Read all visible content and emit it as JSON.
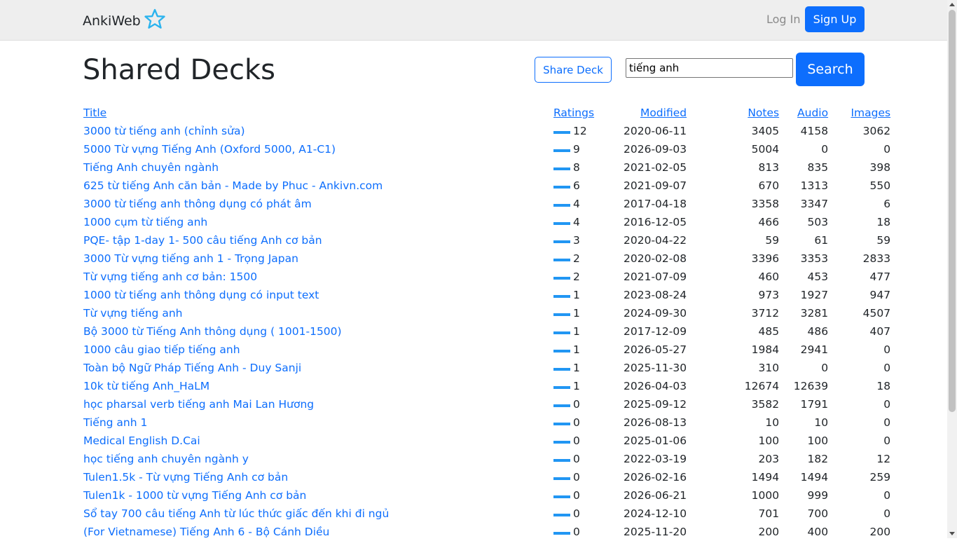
{
  "nav": {
    "brand": "AnkiWeb",
    "login": "Log In",
    "signup": "Sign Up"
  },
  "header": {
    "title": "Shared Decks",
    "share_label": "Share Deck",
    "search_value": "tiếng anh",
    "search_label": "Search"
  },
  "colors": {
    "accent": "#0d6efd",
    "rating_bar": "#2196f3",
    "navbar_bg": "#eeeeee"
  },
  "table": {
    "headers": {
      "title": "Title",
      "ratings": "Ratings",
      "modified": "Modified",
      "notes": "Notes",
      "audio": "Audio",
      "images": "Images"
    },
    "rows": [
      {
        "title": "3000 từ tiếng anh (chỉnh sửa)",
        "ratings": "12",
        "modified": "2020-06-11",
        "notes": "3405",
        "audio": "4158",
        "images": "3062"
      },
      {
        "title": "5000 Từ vựng Tiếng Anh (Oxford 5000, A1-C1)",
        "ratings": "9",
        "modified": "2026-09-03",
        "notes": "5004",
        "audio": "0",
        "images": "0"
      },
      {
        "title": "Tiếng Anh chuyên ngành",
        "ratings": "8",
        "modified": "2021-02-05",
        "notes": "813",
        "audio": "835",
        "images": "398"
      },
      {
        "title": "625 từ tiếng Anh căn bản - Made by Phuc - Ankivn.com",
        "ratings": "6",
        "modified": "2021-09-07",
        "notes": "670",
        "audio": "1313",
        "images": "550"
      },
      {
        "title": "3000 từ tiếng anh thông dụng có phát âm",
        "ratings": "4",
        "modified": "2017-04-18",
        "notes": "3358",
        "audio": "3347",
        "images": "6"
      },
      {
        "title": "1000 cụm từ tiếng anh",
        "ratings": "4",
        "modified": "2016-12-05",
        "notes": "466",
        "audio": "503",
        "images": "18"
      },
      {
        "title": "PQE- tập 1-day 1- 500 câu tiếng Anh cơ bản",
        "ratings": "3",
        "modified": "2020-04-22",
        "notes": "59",
        "audio": "61",
        "images": "59"
      },
      {
        "title": "3000 Từ vựng tiếng anh 1 - Trọng Japan",
        "ratings": "2",
        "modified": "2020-02-08",
        "notes": "3396",
        "audio": "3353",
        "images": "2833"
      },
      {
        "title": "Từ vựng tiếng anh cơ bản: 1500",
        "ratings": "2",
        "modified": "2021-07-09",
        "notes": "460",
        "audio": "453",
        "images": "477"
      },
      {
        "title": "1000 từ tiếng anh thông dụng có input text",
        "ratings": "1",
        "modified": "2023-08-24",
        "notes": "973",
        "audio": "1927",
        "images": "947"
      },
      {
        "title": "Từ vựng tiếng anh",
        "ratings": "1",
        "modified": "2024-09-30",
        "notes": "3712",
        "audio": "3281",
        "images": "4507"
      },
      {
        "title": "Bộ 3000 từ Tiếng Anh thông dụng ( 1001-1500)",
        "ratings": "1",
        "modified": "2017-12-09",
        "notes": "485",
        "audio": "486",
        "images": "407"
      },
      {
        "title": "1000 câu giao tiếp tiếng anh",
        "ratings": "1",
        "modified": "2026-05-27",
        "notes": "1984",
        "audio": "2941",
        "images": "0"
      },
      {
        "title": "Toàn bộ Ngữ Pháp Tiếng Anh - Duy Sanji",
        "ratings": "1",
        "modified": "2025-11-30",
        "notes": "310",
        "audio": "0",
        "images": "0"
      },
      {
        "title": "10k từ tiếng Anh_HaLM",
        "ratings": "1",
        "modified": "2026-04-03",
        "notes": "12674",
        "audio": "12639",
        "images": "18"
      },
      {
        "title": "học pharsal verb tiếng anh Mai Lan Hương",
        "ratings": "0",
        "modified": "2025-09-12",
        "notes": "3582",
        "audio": "1791",
        "images": "0"
      },
      {
        "title": "Tiếng anh 1",
        "ratings": "0",
        "modified": "2026-08-13",
        "notes": "10",
        "audio": "10",
        "images": "0"
      },
      {
        "title": "Medical English D.Cai",
        "ratings": "0",
        "modified": "2025-01-06",
        "notes": "100",
        "audio": "100",
        "images": "0"
      },
      {
        "title": "học tiếng anh chuyên ngành y",
        "ratings": "0",
        "modified": "2022-03-19",
        "notes": "203",
        "audio": "182",
        "images": "12"
      },
      {
        "title": "Tulen1.5k - Từ vựng Tiếng Anh cơ bản",
        "ratings": "0",
        "modified": "2026-02-16",
        "notes": "1494",
        "audio": "1494",
        "images": "259"
      },
      {
        "title": "Tulen1k - 1000 từ vựng Tiếng Anh cơ bản",
        "ratings": "0",
        "modified": "2026-06-21",
        "notes": "1000",
        "audio": "999",
        "images": "0"
      },
      {
        "title": "Sổ tay 700 câu tiếng Anh từ lúc thức giấc đến khi đi ngủ",
        "ratings": "0",
        "modified": "2024-12-10",
        "notes": "701",
        "audio": "700",
        "images": "0"
      },
      {
        "title": "(For Vietnamese) Tiếng Anh 6 - Bộ Cánh Diều",
        "ratings": "0",
        "modified": "2025-11-20",
        "notes": "200",
        "audio": "400",
        "images": "200"
      }
    ]
  }
}
